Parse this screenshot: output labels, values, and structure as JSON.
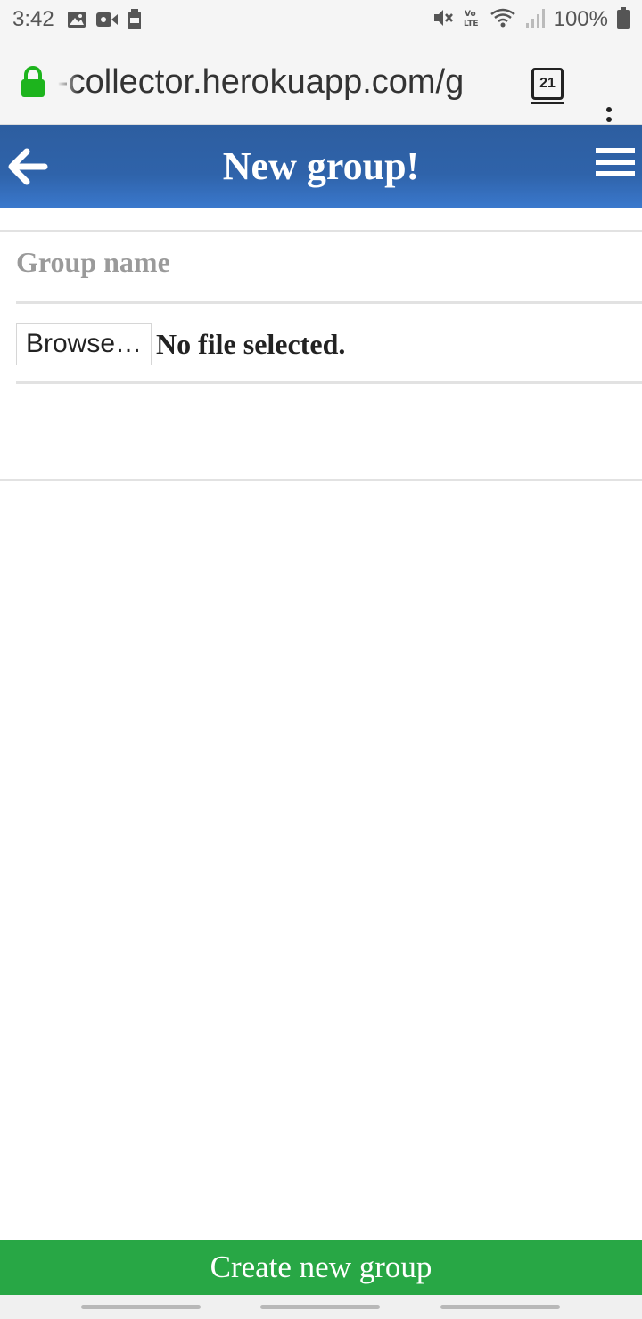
{
  "status_bar": {
    "time": "3:42",
    "battery_text": "100%",
    "left_icons": [
      "image-icon",
      "video-icon",
      "battery-saver-icon"
    ],
    "right_icons": [
      "mute-icon",
      "volte-icon",
      "wifi-icon",
      "signal-icon",
      "battery-icon"
    ]
  },
  "browser": {
    "url": "-collector.herokuapp.com/g",
    "tab_count": "21",
    "lock_color": "#1db41d"
  },
  "header": {
    "title": "New group!",
    "background": "#2f63aa"
  },
  "form": {
    "group_name_placeholder": "Group name",
    "browse_label": "Browse…",
    "file_status": "No file selected."
  },
  "footer": {
    "create_label": "Create new group",
    "button_color": "#28a745"
  }
}
